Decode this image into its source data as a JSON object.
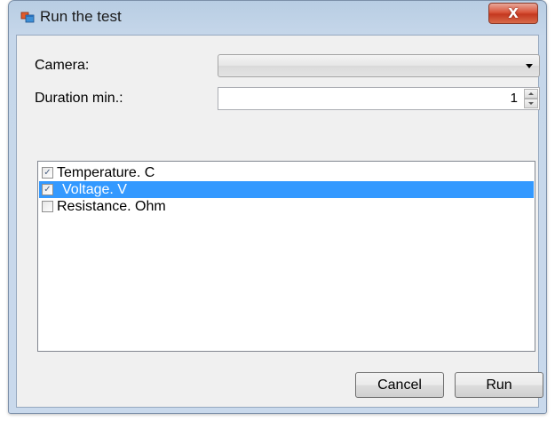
{
  "window": {
    "title": "Run the test",
    "close_glyph": "X",
    "icon": "app-window-icon"
  },
  "form": {
    "camera_label": "Camera:",
    "camera_value": "",
    "duration_label": "Duration min.:",
    "duration_value": "1"
  },
  "measurements": {
    "items": [
      {
        "label": "Temperature. C",
        "checked": true,
        "selected": false
      },
      {
        "label": "Voltage. V",
        "checked": true,
        "selected": true
      },
      {
        "label": "Resistance. Ohm",
        "checked": false,
        "selected": false
      }
    ]
  },
  "buttons": {
    "cancel_label": "Cancel",
    "run_label": "Run"
  },
  "colors": {
    "selection": "#3399ff",
    "close_button": "#d9553b",
    "frame": "#c6d7ea"
  }
}
